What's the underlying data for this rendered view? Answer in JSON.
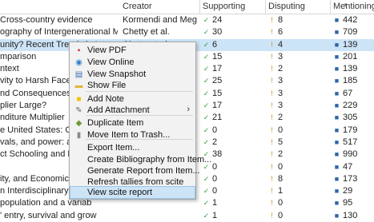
{
  "header": {
    "creator": "Creator",
    "supporting": "Supporting",
    "disputing": "Disputing",
    "mentioning": "Mentioning",
    "sort_indicator": "▾"
  },
  "rows": [
    {
      "title": "Cross-country evidence",
      "creator": "Kormendi and Meguire",
      "supporting": "24",
      "disputing": "8",
      "mentioning": "442",
      "selected": false
    },
    {
      "title": "ography of Intergenerational Mobility i...",
      "creator": "Chetty et al.",
      "supporting": "30",
      "disputing": "6",
      "mentioning": "709",
      "selected": false
    },
    {
      "title": "unity? Recent Trends in Intergeneration...",
      "creator": "Chetty et al.",
      "supporting": "6",
      "disputing": "4",
      "mentioning": "139",
      "selected": true
    },
    {
      "title": "mparison",
      "creator": "",
      "supporting": "15",
      "disputing": "3",
      "mentioning": "201",
      "selected": false
    },
    {
      "title": "ntext",
      "creator": "",
      "supporting": "17",
      "disputing": "2",
      "mentioning": "139",
      "selected": false
    },
    {
      "title": "vity to Harsh Faces and S",
      "creator": "",
      "supporting": "25",
      "disputing": "3",
      "mentioning": "185",
      "selected": false
    },
    {
      "title": "nd Consequences",
      "creator": "",
      "supporting": "15",
      "disputing": "3",
      "mentioning": "67",
      "selected": false
    },
    {
      "title": "plier Large?",
      "creator": "",
      "supporting": "17",
      "disputing": "3",
      "mentioning": "229",
      "selected": false
    },
    {
      "title": "nditure Multiplier",
      "creator": "",
      "supporting": "21",
      "disputing": "2",
      "mentioning": "305",
      "selected": false
    },
    {
      "title": "e United States: Origins a",
      "creator": "",
      "supporting": "0",
      "disputing": "0",
      "mentioning": "179",
      "selected": false
    },
    {
      "title": "vals, and power: a guide",
      "creator": "",
      "supporting": "2",
      "disputing": "5",
      "mentioning": "517",
      "selected": false
    },
    {
      "title": "ct Schooling and Earnin",
      "creator": "",
      "supporting": "38",
      "disputing": "2",
      "mentioning": "990",
      "selected": false
    },
    {
      "title": "",
      "creator": "",
      "supporting": "0",
      "disputing": "0",
      "mentioning": "47",
      "selected": false
    },
    {
      "title": "ity, and Economic Mobili",
      "creator": "",
      "supporting": "0",
      "disputing": "8",
      "mentioning": "173",
      "selected": false
    },
    {
      "title": "n Interdisciplinary Review",
      "creator": "",
      "supporting": "0",
      "disputing": "1",
      "mentioning": "29",
      "selected": false
    },
    {
      "title": "population and a variab",
      "creator": "",
      "supporting": "1",
      "disputing": "0",
      "mentioning": "95",
      "selected": false
    },
    {
      "title": "' entry, survival and grow",
      "creator": "",
      "supporting": "1",
      "disputing": "0",
      "mentioning": "130",
      "selected": false
    }
  ],
  "context_menu": {
    "items": [
      {
        "label": "View PDF",
        "icon": "pdf-icon",
        "glyph": "▪",
        "color": "#d32f2f",
        "has_submenu": false,
        "highlighted": false
      },
      {
        "label": "View Online",
        "icon": "globe-icon",
        "glyph": "◉",
        "color": "#2f7ec9",
        "has_submenu": false,
        "highlighted": false
      },
      {
        "label": "View Snapshot",
        "icon": "snapshot-icon",
        "glyph": "▤",
        "color": "#3a6fb5",
        "has_submenu": false,
        "highlighted": false
      },
      {
        "label": "Show File",
        "icon": "folder-icon",
        "glyph": "▬",
        "color": "#e0b43a",
        "has_submenu": false,
        "highlighted": false
      },
      {
        "label": "Add Note",
        "icon": "note-icon",
        "glyph": "■",
        "color": "#f2c200",
        "has_submenu": false,
        "highlighted": false
      },
      {
        "label": "Add Attachment",
        "icon": "paperclip-icon",
        "glyph": "✎",
        "color": "#666666",
        "has_submenu": true,
        "highlighted": false
      },
      {
        "label": "Duplicate Item",
        "icon": "duplicate-icon",
        "glyph": "◆",
        "color": "#6b9a2f",
        "has_submenu": false,
        "highlighted": false
      },
      {
        "label": "Move Item to Trash...",
        "icon": "trash-icon",
        "glyph": "▮",
        "color": "#8a8a8a",
        "has_submenu": false,
        "highlighted": false
      },
      {
        "label": "Export Item...",
        "icon": "",
        "glyph": "",
        "color": "#000000",
        "has_submenu": false,
        "highlighted": false
      },
      {
        "label": "Create Bibliography from Item...",
        "icon": "",
        "glyph": "",
        "color": "#000000",
        "has_submenu": false,
        "highlighted": false
      },
      {
        "label": "Generate Report from Item...",
        "icon": "",
        "glyph": "",
        "color": "#000000",
        "has_submenu": false,
        "highlighted": false
      },
      {
        "label": "Refresh tallies from scite",
        "icon": "",
        "glyph": "",
        "color": "#000000",
        "has_submenu": false,
        "highlighted": false
      },
      {
        "label": "View scite report",
        "icon": "",
        "glyph": "",
        "color": "#000000",
        "has_submenu": false,
        "highlighted": true
      }
    ],
    "submenu_arrow": "›"
  },
  "colors": {
    "selection": "#cde4f7",
    "supporting": "#3d9b47",
    "disputing": "#d18a1a",
    "mentioning": "#2e64a8"
  }
}
